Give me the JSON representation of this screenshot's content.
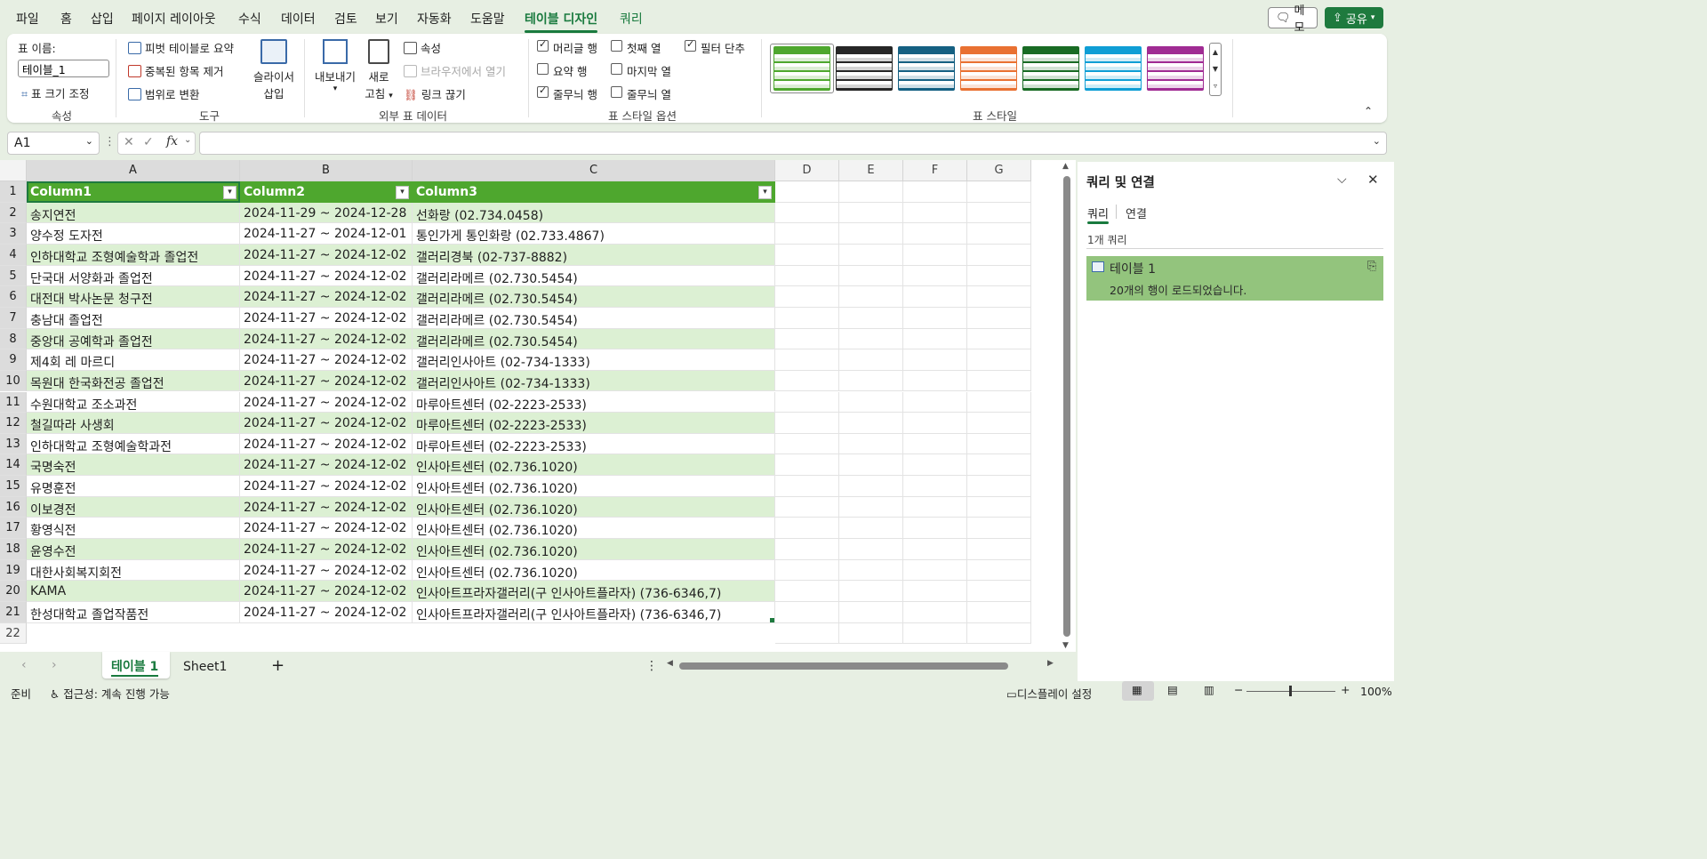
{
  "menu": {
    "tabs": [
      "파일",
      "홈",
      "삽입",
      "페이지 레이아웃",
      "수식",
      "데이터",
      "검토",
      "보기",
      "자동화",
      "도움말",
      "테이블 디자인",
      "쿼리"
    ],
    "active": "테이블 디자인",
    "memo": "메모",
    "share": "공유"
  },
  "ribbon": {
    "props": {
      "name_label": "표 이름:",
      "name_value": "테이블_1",
      "resize": "표 크기 조정",
      "group": "속성"
    },
    "tools": {
      "pivot": "피벗 테이블로 요약",
      "dedupe": "중복된 항목 제거",
      "convert": "범위로 변환",
      "slicer1": "슬라이서",
      "slicer2": "삽입",
      "group": "도구"
    },
    "external": {
      "export": "내보내기",
      "refresh1": "새로",
      "refresh2": "고침",
      "properties": "속성",
      "open_browser": "브라우저에서 열기",
      "unlink": "링크 끊기",
      "group": "외부 표 데이터"
    },
    "options": {
      "header_row": "머리글 행",
      "total_row": "요약 행",
      "banded_rows": "줄무늬 행",
      "first_col": "첫째 열",
      "last_col": "마지막 열",
      "banded_cols": "줄무늬 열",
      "filter_btn": "필터 단추",
      "group": "표 스타일 옵션"
    },
    "styles": {
      "group": "표 스타일",
      "swatches": [
        "#4ea72e",
        "#262626",
        "#156082",
        "#e97132",
        "#196b24",
        "#0f9ed5",
        "#a02b93"
      ]
    }
  },
  "formula": {
    "cell_ref": "A1",
    "fx": "fx",
    "value": ""
  },
  "grid": {
    "columns": [
      "A",
      "B",
      "C",
      "D",
      "E",
      "F",
      "G"
    ],
    "headers": [
      "Column1",
      "Column2",
      "Column3"
    ],
    "rows": [
      [
        "송지연전",
        "2024-11-29 ~ 2024-12-28",
        "선화랑  (02.734.0458)"
      ],
      [
        "양수정 도자전",
        "2024-11-27 ~ 2024-12-01",
        "통인가게 통인화랑  (02.733.4867)"
      ],
      [
        "인하대학교 조형예술학과 졸업전",
        "2024-11-27 ~ 2024-12-02",
        "갤러리경북  (02-737-8882)"
      ],
      [
        "단국대 서양화과 졸업전",
        "2024-11-27 ~ 2024-12-02",
        "갤러리라메르  (02.730.5454)"
      ],
      [
        "대전대 박사논문 청구전",
        "2024-11-27 ~ 2024-12-02",
        "갤러리라메르  (02.730.5454)"
      ],
      [
        "충남대 졸업전",
        "2024-11-27 ~ 2024-12-02",
        "갤러리라메르  (02.730.5454)"
      ],
      [
        "중앙대 공예학과 졸업전",
        "2024-11-27 ~ 2024-12-02",
        "갤러리라메르  (02.730.5454)"
      ],
      [
        "제4회 레 마르디",
        "2024-11-27 ~ 2024-12-02",
        "갤러리인사아트  (02-734-1333)"
      ],
      [
        "목원대 한국화전공 졸업전",
        "2024-11-27 ~ 2024-12-02",
        "갤러리인사아트  (02-734-1333)"
      ],
      [
        "수원대학교 조소과전",
        "2024-11-27 ~ 2024-12-02",
        "마루아트센터  (02-2223-2533)"
      ],
      [
        "철길따라 사생회",
        "2024-11-27 ~ 2024-12-02",
        "마루아트센터  (02-2223-2533)"
      ],
      [
        "인하대학교 조형예술학과전",
        "2024-11-27 ~ 2024-12-02",
        "마루아트센터  (02-2223-2533)"
      ],
      [
        "국명숙전",
        "2024-11-27 ~ 2024-12-02",
        "인사아트센터    (02.736.1020)"
      ],
      [
        "유명훈전",
        "2024-11-27 ~ 2024-12-02",
        "인사아트센터    (02.736.1020)"
      ],
      [
        "이보경전",
        "2024-11-27 ~ 2024-12-02",
        "인사아트센터    (02.736.1020)"
      ],
      [
        "황영식전",
        "2024-11-27 ~ 2024-12-02",
        "인사아트센터    (02.736.1020)"
      ],
      [
        "윤영수전",
        "2024-11-27 ~ 2024-12-02",
        "인사아트센터    (02.736.1020)"
      ],
      [
        "대한사회복지회전",
        "2024-11-27 ~ 2024-12-02",
        "인사아트센터    (02.736.1020)"
      ],
      [
        "KAMA",
        "2024-11-27 ~ 2024-12-02",
        "인사아트프라자갤러리(구 인사아트플라자)  (736-6346,7)"
      ],
      [
        "한성대학교 졸업작품전",
        "2024-11-27 ~ 2024-12-02",
        "인사아트프라자갤러리(구 인사아트플라자)  (736-6346,7)"
      ]
    ],
    "row_numbers": [
      "1",
      "2",
      "3",
      "4",
      "5",
      "6",
      "7",
      "8",
      "9",
      "10",
      "11",
      "12",
      "13",
      "14",
      "15",
      "16",
      "17",
      "18",
      "19",
      "20",
      "21",
      "22"
    ]
  },
  "sheets": {
    "tabs": [
      "테이블 1",
      "Sheet1"
    ],
    "active": "테이블 1",
    "add": "+"
  },
  "pane": {
    "title": "쿼리 및 연결",
    "tab_query": "쿼리",
    "tab_conn": "연결",
    "count": "1개 쿼리",
    "item_name": "테이블 1",
    "item_status": "20개의 행이 로드되었습니다."
  },
  "status": {
    "ready": "준비",
    "accessibility": "접근성: 계속 진행 가능",
    "display": "디스플레이 설정",
    "zoom": "100%"
  }
}
